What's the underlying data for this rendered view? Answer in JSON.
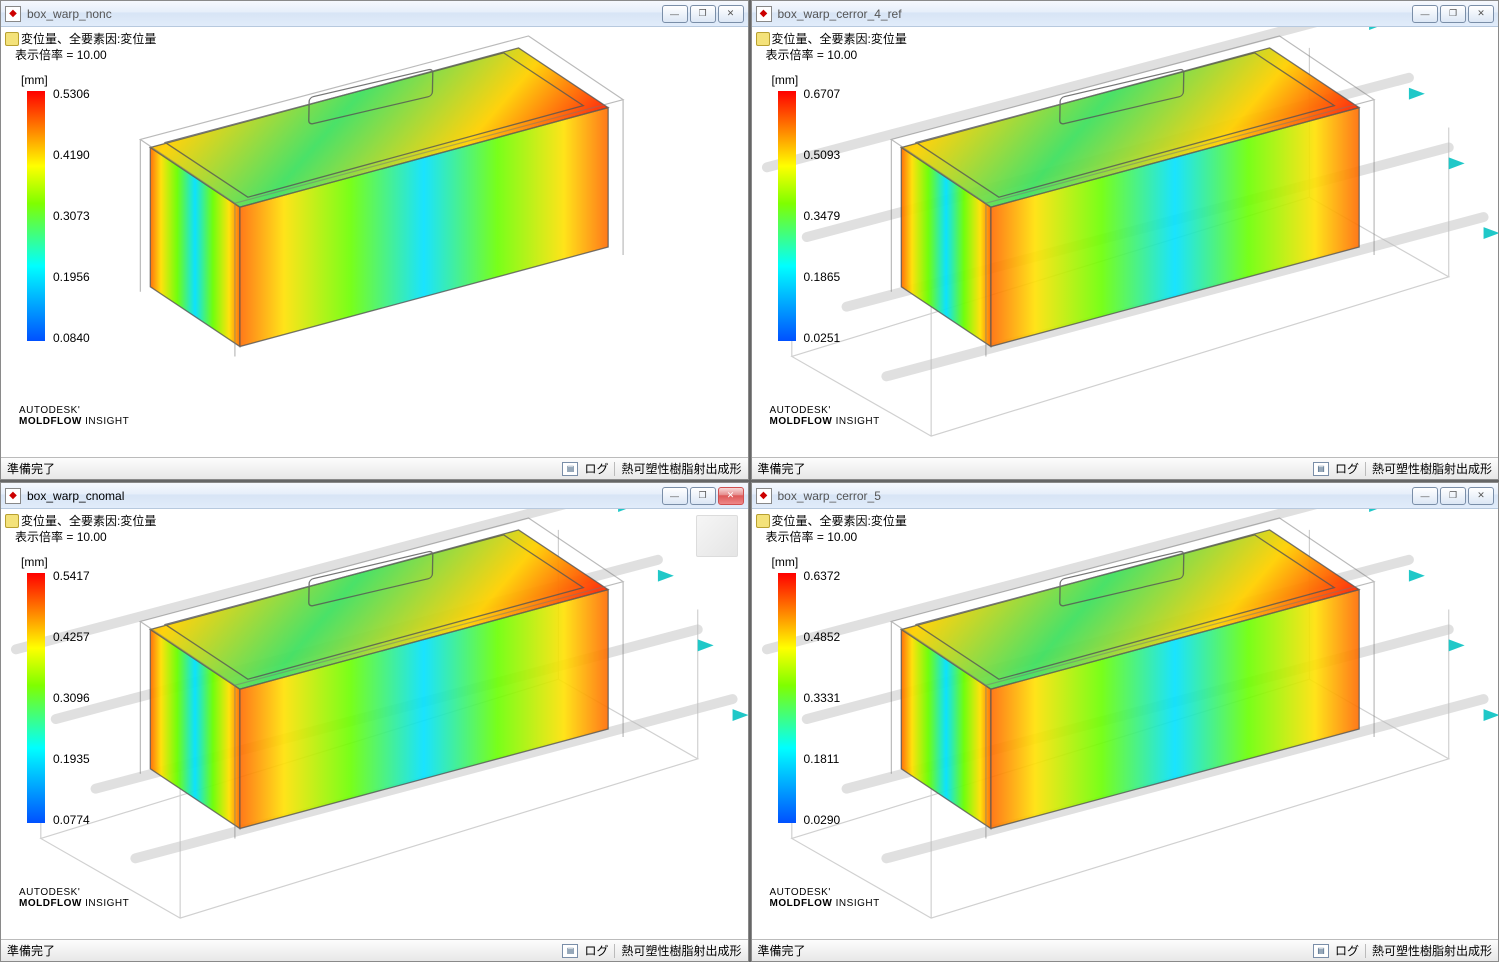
{
  "panes": [
    {
      "title": "box_warp_nonc",
      "active": false,
      "close_style": "normal",
      "overlay": {
        "line1": "変位量、全要素因:変位量",
        "line2": "表示倍率 = 10.00"
      },
      "unit": "[mm]",
      "legend_values": [
        "0.5306",
        "0.4190",
        "0.3073",
        "0.1956",
        "0.0840"
      ],
      "brand": {
        "line1": "AUTODESK'",
        "line2a": "MOLDFLOW",
        "line2b": "INSIGHT"
      },
      "status": {
        "left": "準備完了",
        "log": "ログ",
        "mode": "熱可塑性樹脂射出成形"
      },
      "has_cooling": false,
      "show_cube": false
    },
    {
      "title": "box_warp_cerror_4_ref",
      "active": false,
      "close_style": "normal",
      "overlay": {
        "line1": "変位量、全要素因:変位量",
        "line2": "表示倍率 = 10.00"
      },
      "unit": "[mm]",
      "legend_values": [
        "0.6707",
        "0.5093",
        "0.3479",
        "0.1865",
        "0.0251"
      ],
      "brand": {
        "line1": "AUTODESK'",
        "line2a": "MOLDFLOW",
        "line2b": "INSIGHT"
      },
      "status": {
        "left": "準備完了",
        "log": "ログ",
        "mode": "熱可塑性樹脂射出成形"
      },
      "has_cooling": true,
      "show_cube": false
    },
    {
      "title": "box_warp_cnomal",
      "active": true,
      "close_style": "active",
      "overlay": {
        "line1": "変位量、全要素因:変位量",
        "line2": "表示倍率 = 10.00"
      },
      "unit": "[mm]",
      "legend_values": [
        "0.5417",
        "0.4257",
        "0.3096",
        "0.1935",
        "0.0774"
      ],
      "brand": {
        "line1": "AUTODESK'",
        "line2a": "MOLDFLOW",
        "line2b": "INSIGHT"
      },
      "status": {
        "left": "準備完了",
        "log": "ログ",
        "mode": "熱可塑性樹脂射出成形"
      },
      "has_cooling": true,
      "show_cube": true
    },
    {
      "title": "box_warp_cerror_5",
      "active": false,
      "close_style": "normal",
      "overlay": {
        "line1": "変位量、全要素因:変位量",
        "line2": "表示倍率 = 10.00"
      },
      "unit": "[mm]",
      "legend_values": [
        "0.6372",
        "0.4852",
        "0.3331",
        "0.1811",
        "0.0290"
      ],
      "brand": {
        "line1": "AUTODESK'",
        "line2a": "MOLDFLOW",
        "line2b": "INSIGHT"
      },
      "status": {
        "left": "準備完了",
        "log": "ログ",
        "mode": "熱可塑性樹脂射出成形"
      },
      "has_cooling": true,
      "show_cube": false
    }
  ],
  "win_buttons": {
    "min": "—",
    "max": "❐",
    "close": "✕"
  }
}
